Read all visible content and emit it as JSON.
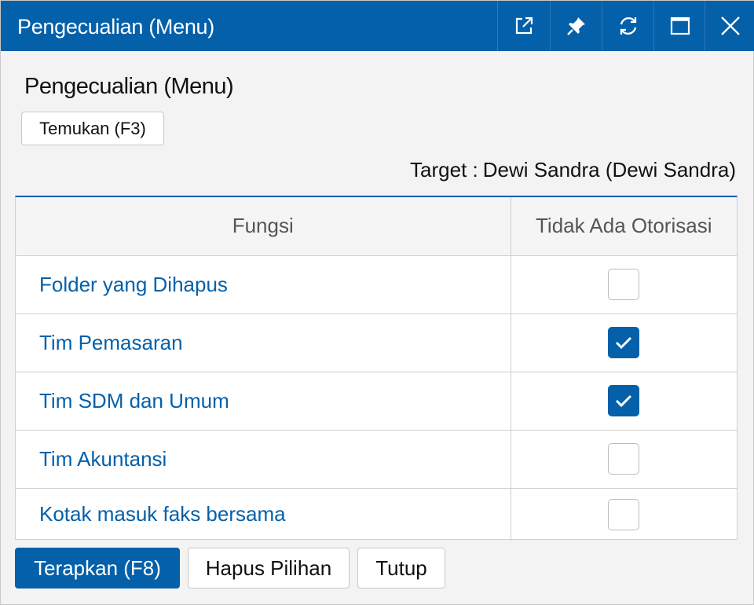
{
  "window": {
    "title": "Pengecualian (Menu)",
    "buttons": [
      {
        "name": "open-external",
        "icon": "external-link-icon"
      },
      {
        "name": "pin",
        "icon": "pin-icon"
      },
      {
        "name": "refresh",
        "icon": "refresh-icon"
      },
      {
        "name": "maximize",
        "icon": "maximize-icon"
      },
      {
        "name": "close",
        "icon": "close-icon"
      }
    ],
    "accent_color": "#0460a9"
  },
  "heading": "Pengecualian (Menu)",
  "find_button": "Temukan (F3)",
  "target": {
    "label": "Target :",
    "value": "Dewi Sandra (Dewi Sandra)"
  },
  "table": {
    "columns": [
      "Fungsi",
      "Tidak Ada Otorisasi"
    ],
    "rows": [
      {
        "function": "Folder yang Dihapus",
        "no_authorization": false
      },
      {
        "function": "Tim Pemasaran",
        "no_authorization": true
      },
      {
        "function": "Tim SDM dan Umum",
        "no_authorization": true
      },
      {
        "function": "Tim Akuntansi",
        "no_authorization": false
      },
      {
        "function": "Kotak masuk faks bersama",
        "no_authorization": false
      }
    ]
  },
  "footer": {
    "apply": "Terapkan (F8)",
    "clear": "Hapus Pilihan",
    "close": "Tutup"
  }
}
